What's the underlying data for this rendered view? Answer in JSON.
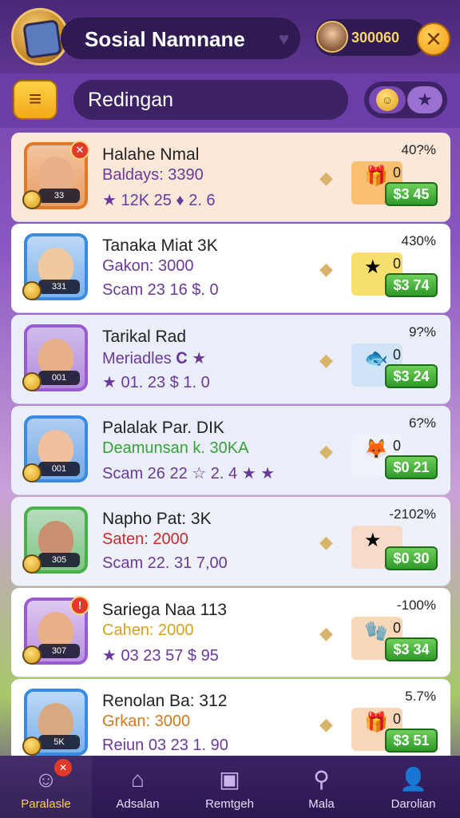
{
  "header": {
    "title": "Sosial Namnane",
    "coins": "300060",
    "close_symbol": "✕"
  },
  "subheader": {
    "menu_symbol": "≡",
    "section_title": "Redingan",
    "segment_a_icon": "coin-icon",
    "segment_b_icon": "star-icon",
    "segment_b_symbol": "★"
  },
  "cards": [
    {
      "name": "Halahe Nmal",
      "sub": "Baldays: 3390",
      "stats": "★ 12K 25 ♦ 2. 6",
      "level": "33",
      "pct": "40?%",
      "zero": "0",
      "price": "$3 45",
      "bg": "#fbe8d8",
      "frame": "#e07a2a",
      "reward_bg": "#f8c070",
      "reward_glyph": "🎁",
      "sub_color": "#6a3a9a",
      "notif": "✕"
    },
    {
      "name": "Tanaka Miat 3K",
      "sub": "Gakon: 3000",
      "stats": "Scam 23 16 $. 0",
      "level": "331",
      "pct": "430%",
      "zero": "0",
      "price": "$3 74",
      "bg": "#ffffff",
      "frame": "#3a8ae0",
      "reward_bg": "#f8e070",
      "reward_glyph": "★",
      "sub_color": "#6a3a9a",
      "notif": ""
    },
    {
      "name": "Tarikal Rad",
      "sub": "Meriadles 𝐂 ★",
      "stats": "★ 01. 23 $ 1. 0",
      "level": "001",
      "pct": "9?%",
      "zero": "0",
      "price": "$3 24",
      "bg": "#eaeef8",
      "frame": "#9a5ad0",
      "reward_bg": "#cfe4f6",
      "reward_glyph": "🐟",
      "sub_color": "#6a3a9a",
      "notif": ""
    },
    {
      "name": "Palalak Par. DIK",
      "sub": "Deamunsan k. 30KA",
      "stats": "Scam 26 22 ☆ 2. 4 ★ ★",
      "level": "001",
      "pct": "6?%",
      "zero": "0",
      "price": "$0 21",
      "bg": "#eaeef8",
      "frame": "#3a8ae0",
      "reward_bg": "#eef2fb",
      "reward_glyph": "🦊",
      "sub_color": "#3aa03a",
      "notif": ""
    },
    {
      "name": "Napho Pat: 3K",
      "sub": "Saten: 2000",
      "stats": "Scam 22. 31 7,00",
      "level": "305",
      "pct": "-2102%",
      "zero": "",
      "price": "$0 30",
      "bg": "#eef1fa",
      "frame": "#4ab04a",
      "reward_bg": "#f6dcc8",
      "reward_glyph": "★",
      "sub_color": "#c82a2a",
      "notif": ""
    },
    {
      "name": "Sariega Naa 113",
      "sub": "Cahen: 2000",
      "stats": "★ 03 23 57 $ 95",
      "level": "307",
      "pct": "-100%",
      "zero": "0",
      "price": "$3 34",
      "bg": "#ffffff",
      "frame": "#9a5ad0",
      "reward_bg": "#f8d8b8",
      "reward_glyph": "🧤",
      "sub_color": "#d4a020",
      "notif": "!"
    },
    {
      "name": "Renolan Ba: 312",
      "sub": "Grkan: 3000",
      "stats": "Reiun 03 23 1. 90",
      "level": "5K",
      "pct": "5.7%",
      "zero": "0",
      "price": "$3 51",
      "bg": "#ffffff",
      "frame": "#3a8ae0",
      "reward_bg": "#f8d8b8",
      "reward_glyph": "🎁",
      "sub_color": "#d07a20",
      "notif": ""
    }
  ],
  "nav": [
    {
      "label": "Paralasle",
      "icon": "avatar-icon",
      "symbol": "☺",
      "badge": "✕",
      "active": true
    },
    {
      "label": "Adsalan",
      "icon": "home-icon",
      "symbol": "⌂",
      "badge": "",
      "active": false
    },
    {
      "label": "Remtgeh",
      "icon": "chart-icon",
      "symbol": "▣",
      "badge": "",
      "active": false
    },
    {
      "label": "Mala",
      "icon": "search-icon",
      "symbol": "⚲",
      "badge": "",
      "active": false
    },
    {
      "label": "Darolian",
      "icon": "profile-icon",
      "symbol": "👤",
      "badge": "",
      "active": false
    }
  ]
}
